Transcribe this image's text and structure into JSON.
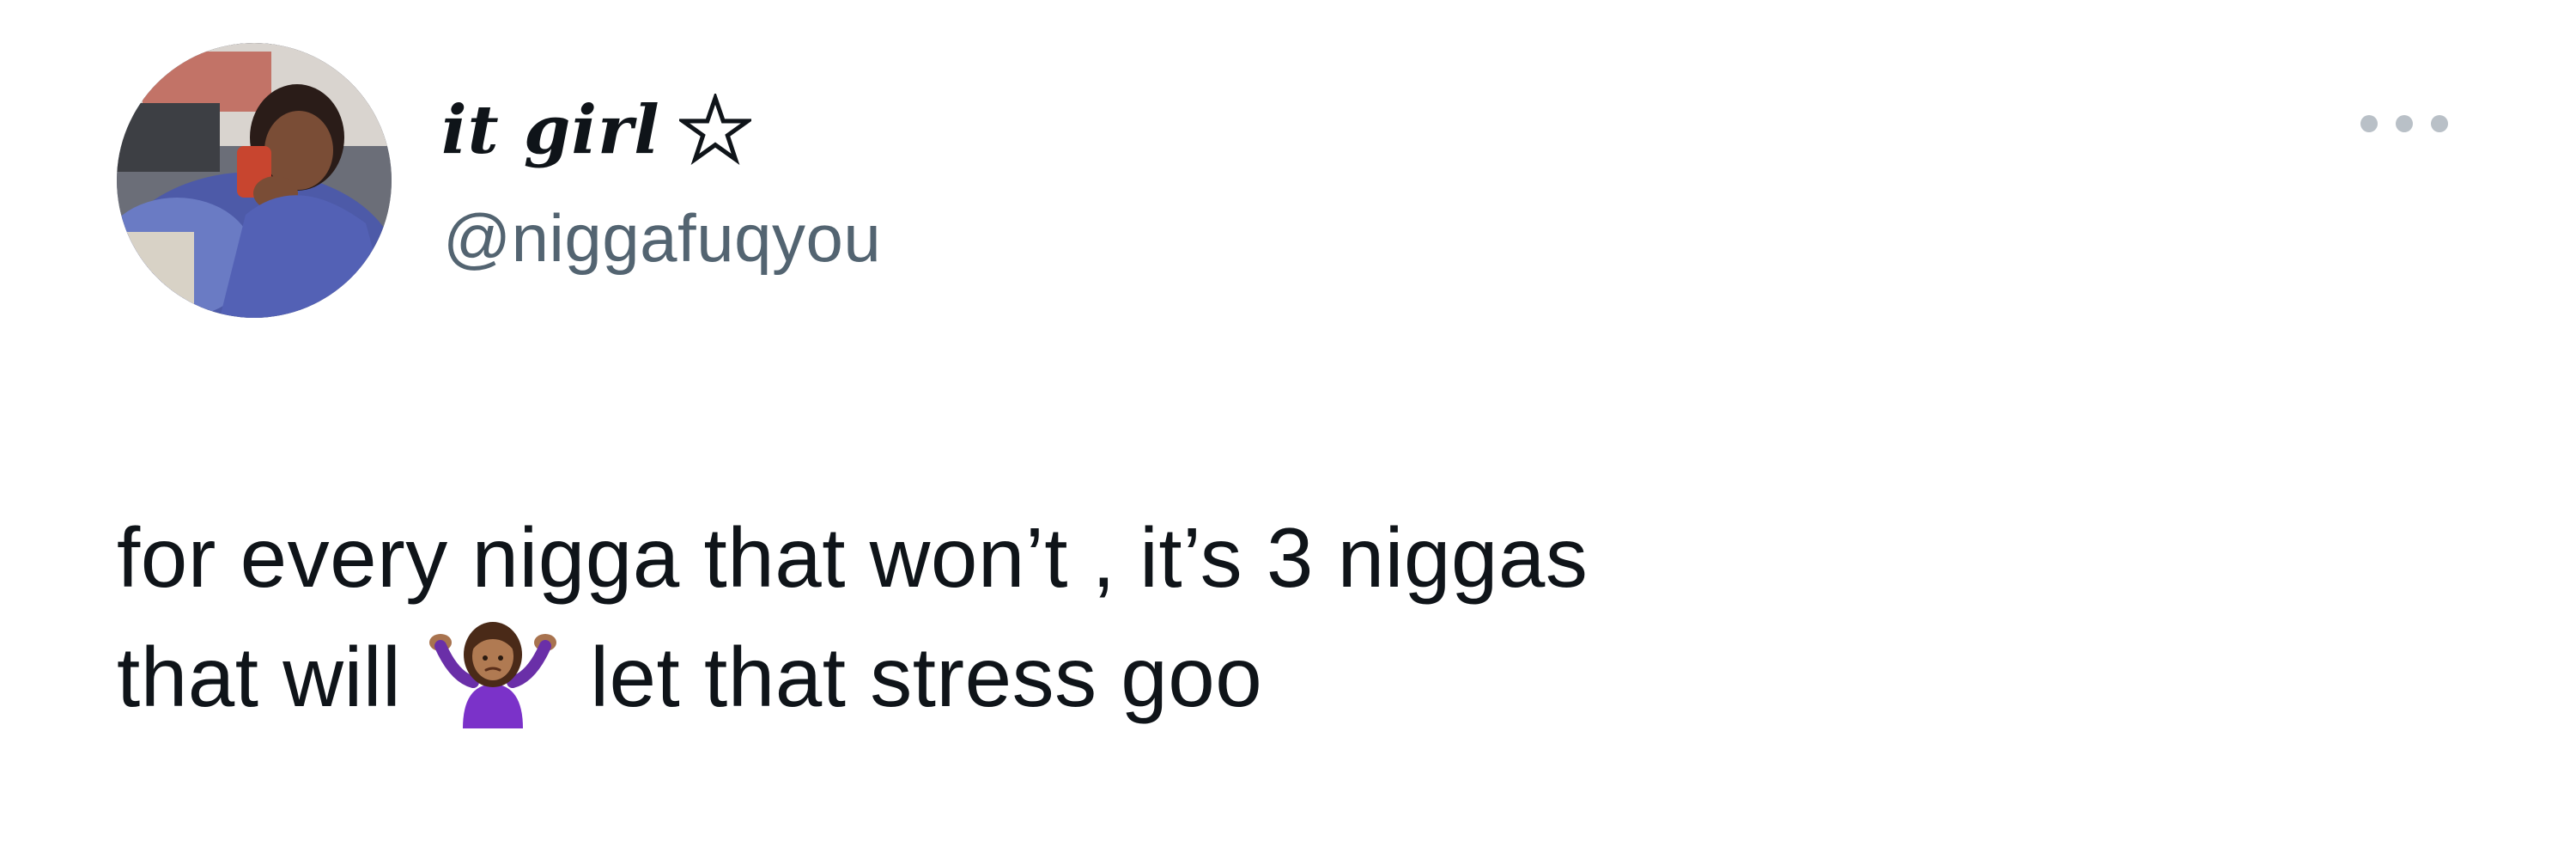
{
  "author": {
    "display_name": "it girl",
    "display_name_badge": "☆",
    "handle": "@niggafuqyou",
    "avatar": "avatar-photo"
  },
  "menu": {
    "icon": "more-horizontal-icon"
  },
  "tweet": {
    "line1": "for every nigga that won’t , it’s 3 niggas",
    "line2_before_emoji": "that will",
    "emoji": "🤷🏽‍♀️",
    "emoji_icon": "woman-shrugging-emoji",
    "line2_after_emoji": "let that stress goo"
  },
  "colors": {
    "text_primary": "#0f1419",
    "text_secondary": "#536471",
    "background": "#ffffff",
    "menu_dots": "#b9c0c7"
  }
}
